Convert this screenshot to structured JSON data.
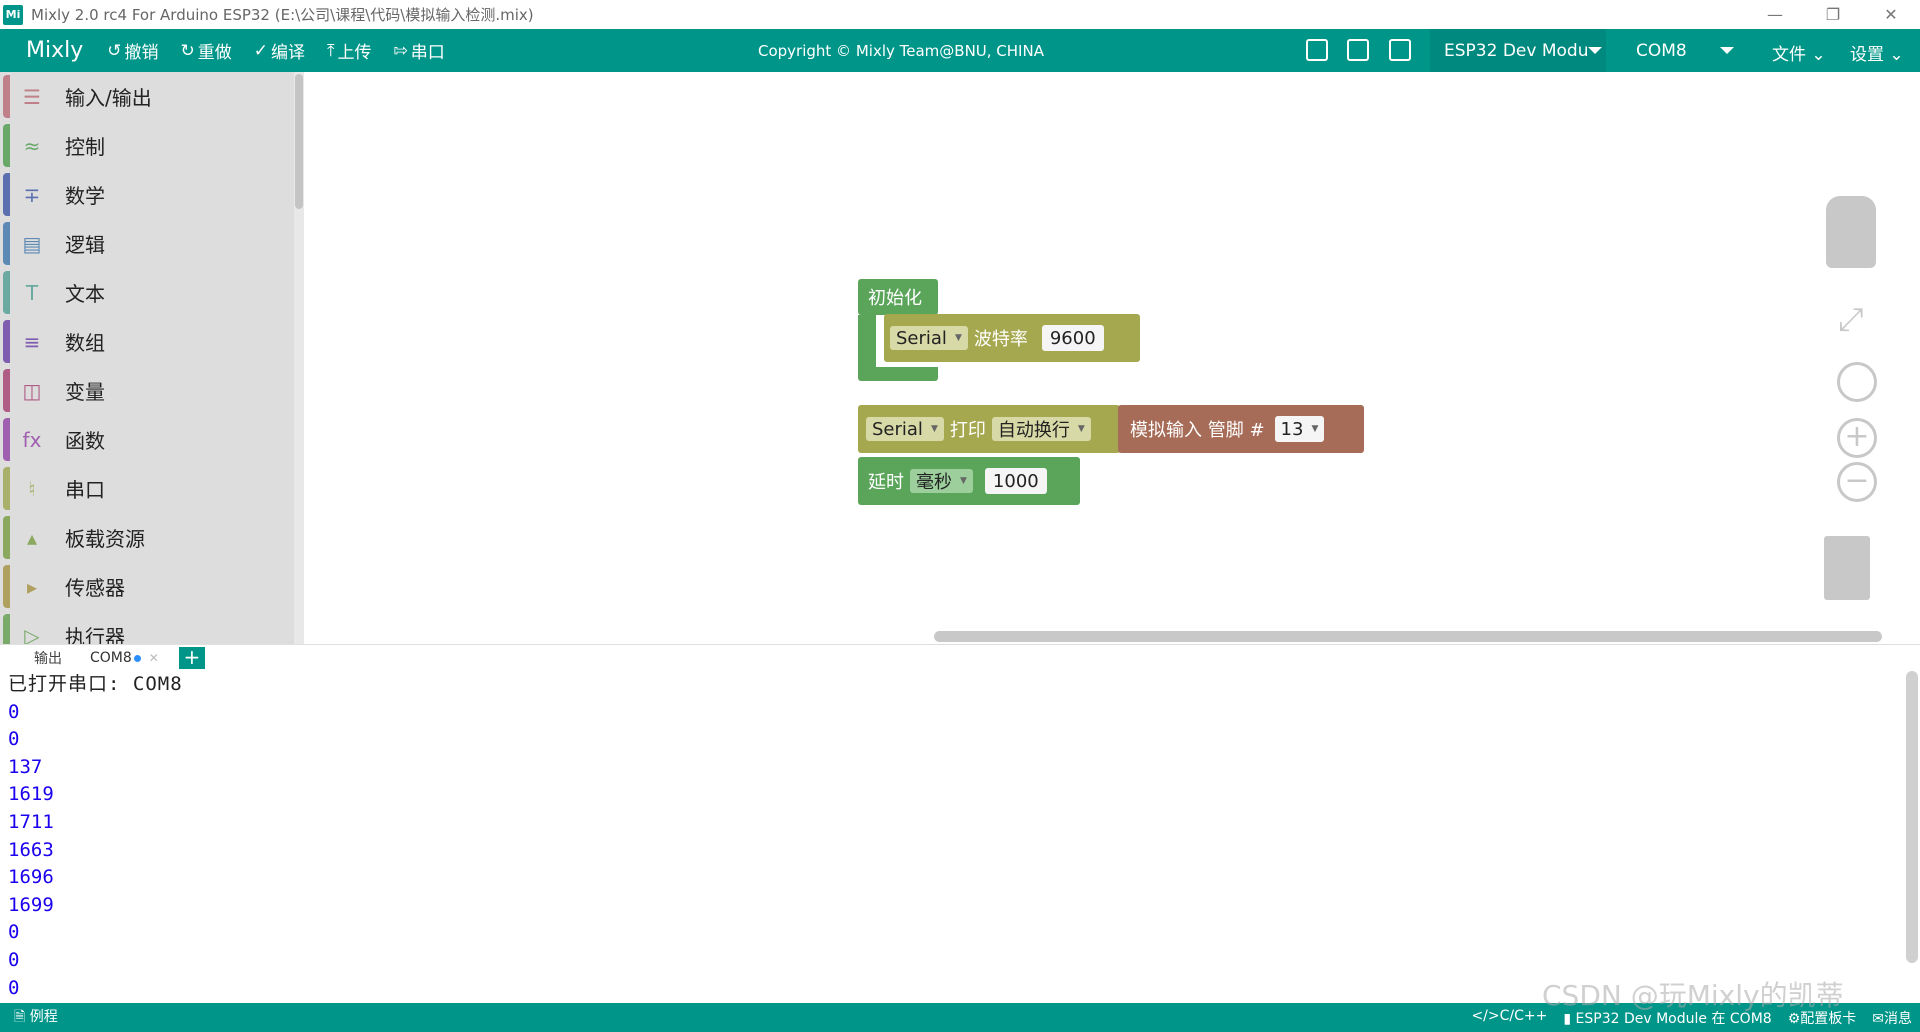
{
  "window": {
    "logo_text": "Mi",
    "title": "Mixly 2.0 rc4 For Arduino ESP32 (E:\\公司\\课程\\代码\\模拟输入检测.mix)"
  },
  "toolbar": {
    "brand": "Mixly",
    "undo": "撤销",
    "redo": "重做",
    "compile": "编译",
    "upload": "上传",
    "serial": "串口",
    "copyright": "Copyright © Mixly Team@BNU, CHINA",
    "board": "ESP32 Dev Modu",
    "port": "COM8",
    "file_menu": "文件",
    "settings_menu": "设置"
  },
  "sidebar": {
    "categories": [
      {
        "label": "输入/输出",
        "color": "#c0808a",
        "icon": "io-icon"
      },
      {
        "label": "控制",
        "color": "#6aa86a",
        "icon": "control-icon"
      },
      {
        "label": "数学",
        "color": "#5b6fb0",
        "icon": "math-icon"
      },
      {
        "label": "逻辑",
        "color": "#5c8ab5",
        "icon": "logic-icon"
      },
      {
        "label": "文本",
        "color": "#6aaaa0",
        "icon": "text-icon"
      },
      {
        "label": "数组",
        "color": "#7e5db0",
        "icon": "array-icon"
      },
      {
        "label": "变量",
        "color": "#b05d85",
        "icon": "variable-icon"
      },
      {
        "label": "函数",
        "color": "#a060b0",
        "icon": "function-icon"
      },
      {
        "label": "串口",
        "color": "#a8b06a",
        "icon": "serial-icon"
      },
      {
        "label": "板载资源",
        "color": "#8aa85e",
        "icon": "board-resource-icon"
      },
      {
        "label": "传感器",
        "color": "#b0a060",
        "icon": "sensor-icon"
      },
      {
        "label": "执行器",
        "color": "#7aaa6a",
        "icon": "actuator-icon"
      }
    ]
  },
  "blocks": {
    "setup_title": "初始化",
    "setup_serial": "Serial",
    "setup_baud_label": "波特率",
    "setup_baud_value": "9600",
    "print_serial": "Serial",
    "print_label": "打印",
    "print_mode": "自动换行",
    "analog_label": "模拟输入 管脚 #",
    "analog_pin": "13",
    "delay_label": "延时",
    "delay_unit": "毫秒",
    "delay_value": "1000"
  },
  "panel": {
    "tab_output": "输出",
    "tab_com": "COM8",
    "console_header": "已打开串口: COM8",
    "console_lines": [
      "0",
      "0",
      "137",
      "1619",
      "1711",
      "1663",
      "1696",
      "1699",
      "0",
      "0",
      "0"
    ]
  },
  "statusbar": {
    "examples": "例程",
    "language": "C/C++",
    "board_info": "ESP32 Dev Module 在 COM8",
    "config": "配置板卡",
    "messages": "消息"
  },
  "watermark": "CSDN @玩Mixly的凯蒂"
}
